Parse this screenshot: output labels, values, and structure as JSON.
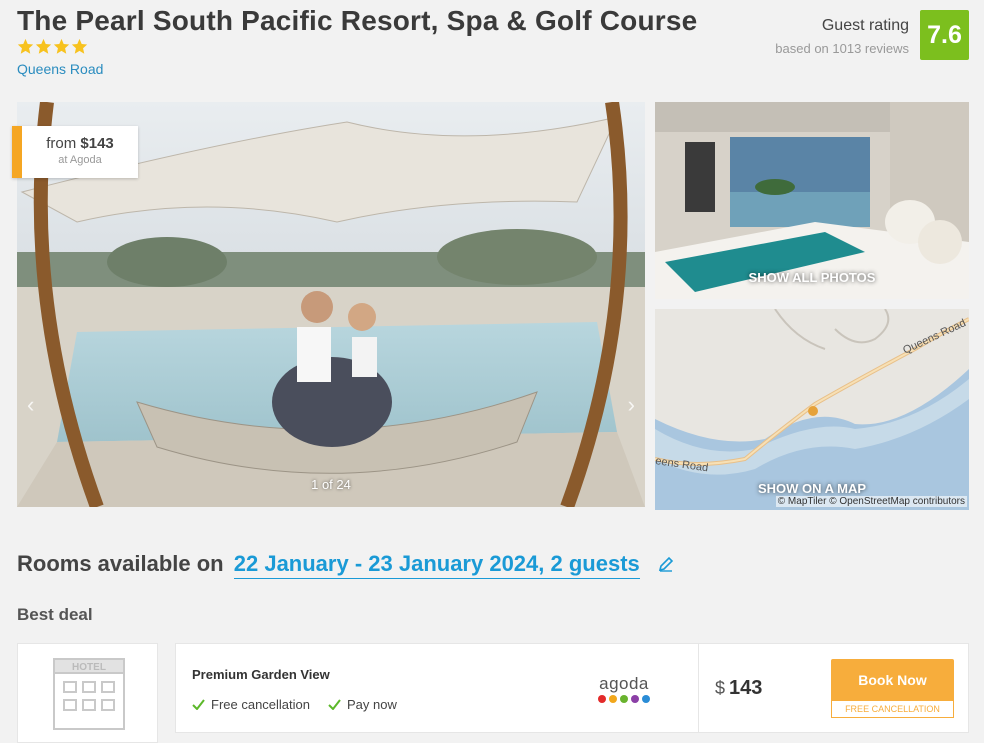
{
  "hotel": {
    "name": "The Pearl South Pacific Resort, Spa & Golf Course",
    "stars": 4,
    "address": "Queens Road"
  },
  "rating": {
    "label": "Guest rating",
    "reviews": "based on 1013 reviews",
    "score": "7.6",
    "color": "#7cbf1e"
  },
  "gallery": {
    "price_from": "from",
    "price_currency": "$",
    "price_value": "143",
    "price_source": "at Agoda",
    "counter": "1 of 24",
    "show_all_photos": "SHOW ALL PHOTOS",
    "show_on_map": "SHOW ON A MAP",
    "map_credit": "© MapTiler © OpenStreetMap contributors",
    "map_road_1": "Queens Road",
    "map_road_2": "eens Road"
  },
  "rooms": {
    "heading_prefix": "Rooms available on",
    "dates": "22 January - 23 January 2024, 2 guests"
  },
  "best_deal": {
    "heading": "Best deal",
    "thumb_label": "HOTEL",
    "room_name": "Premium Garden View",
    "features": [
      "Free cancellation",
      "Pay now"
    ],
    "provider": "agoda",
    "currency": "$",
    "price": "143",
    "book_label": "Book Now",
    "cancel_label": "FREE CANCELLATION",
    "accent": "#f7ad3c"
  }
}
